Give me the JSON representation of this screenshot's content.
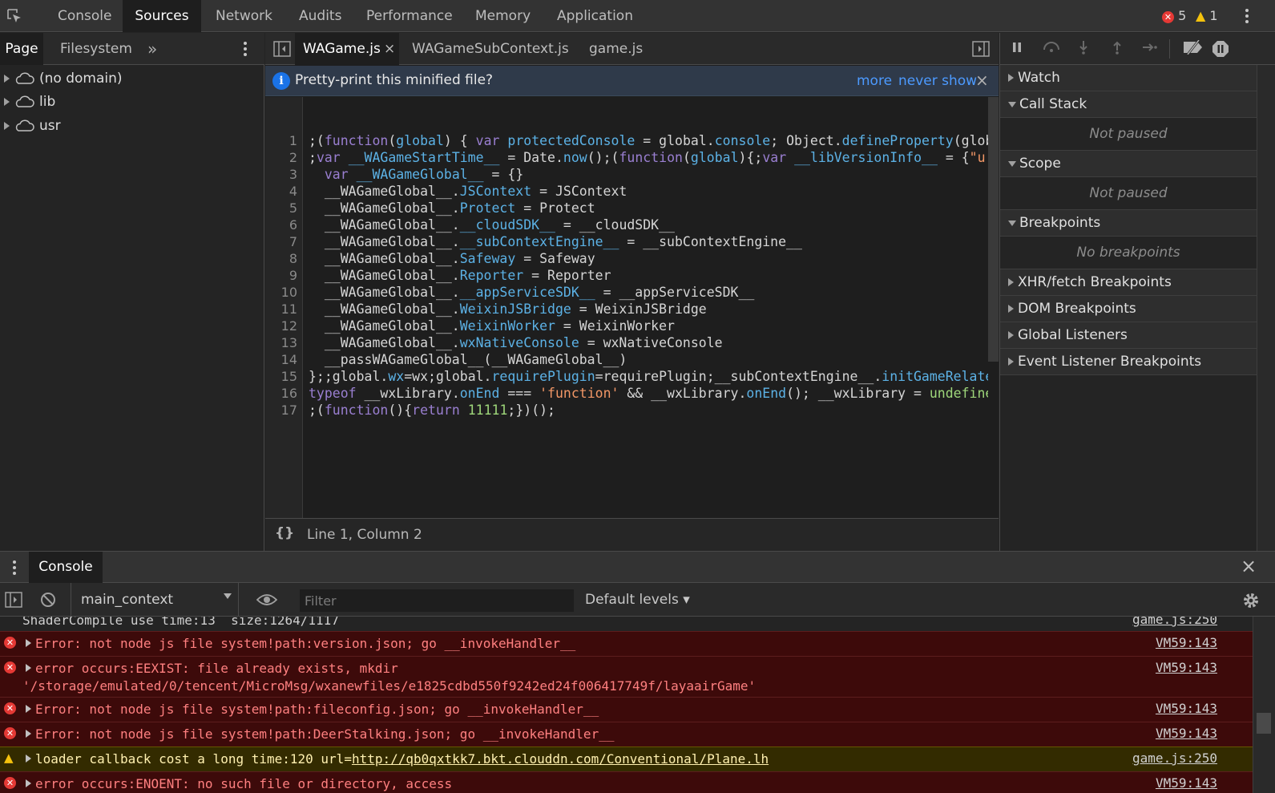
{
  "topbar": {
    "tabs": [
      "Console",
      "Sources",
      "Network",
      "Audits",
      "Performance",
      "Memory",
      "Application"
    ],
    "active_tab": "Sources",
    "error_count": "5",
    "warning_count": "1"
  },
  "navigator": {
    "tabs": [
      "Page",
      "Filesystem"
    ],
    "more": "»",
    "tree": [
      "(no domain)",
      "lib",
      "usr"
    ]
  },
  "editor": {
    "tabs": [
      "WAGame.js",
      "WAGameSubContext.js",
      "game.js"
    ],
    "close_glyph": "×",
    "infobar": {
      "message": "Pretty-print this minified file?",
      "more": "more",
      "never_show": "never show",
      "close": "×"
    },
    "line_numbers": [
      "1",
      "2",
      "3",
      "4",
      "5",
      "6",
      "7",
      "8",
      "9",
      "10",
      "11",
      "12",
      "13",
      "14",
      "15",
      "16",
      "17"
    ],
    "status": {
      "format_glyph": "{}",
      "position": "Line 1, Column 2"
    }
  },
  "debugger": {
    "sections": {
      "watch": "Watch",
      "call_stack": "Call Stack",
      "call_stack_body": "Not paused",
      "scope": "Scope",
      "scope_body": "Not paused",
      "breakpoints": "Breakpoints",
      "breakpoints_body": "No breakpoints",
      "xhr": "XHR/fetch Breakpoints",
      "dom": "DOM Breakpoints",
      "global": "Global Listeners",
      "event": "Event Listener Breakpoints"
    }
  },
  "drawer": {
    "tab": "Console",
    "close": "×",
    "context": "main_context",
    "filter_placeholder": "Filter",
    "levels": "Default levels ▾"
  },
  "messages": [
    {
      "level": "plain",
      "text": "ShaderCompile use time:13  size:1264/1117",
      "source": "game.js:250"
    },
    {
      "level": "error",
      "text": "Error: not node js file system!path:version.json; go __invokeHandler__",
      "source": "VM59:143"
    },
    {
      "level": "error",
      "text": "error occurs:EEXIST: file already exists, mkdir",
      "text2": "'/storage/emulated/0/tencent/MicroMsg/wxanewfiles/e1825cdbd550f9242ed24f006417749f/layaairGame'",
      "source": "VM59:143"
    },
    {
      "level": "error",
      "text": "Error: not node js file system!path:fileconfig.json; go __invokeHandler__",
      "source": "VM59:143"
    },
    {
      "level": "error",
      "text": "Error: not node js file system!path:DeerStalking.json; go __invokeHandler__",
      "source": "VM59:143"
    },
    {
      "level": "warning",
      "text": "loader callback cost a long time:120 url=",
      "url": "http://qb0qxtkk7.bkt.clouddn.com/Conventional/Plane.lh",
      "source": "game.js:250"
    },
    {
      "level": "error",
      "text": "error occurs:ENOENT: no such file or directory, access",
      "source": "VM59:143"
    }
  ]
}
